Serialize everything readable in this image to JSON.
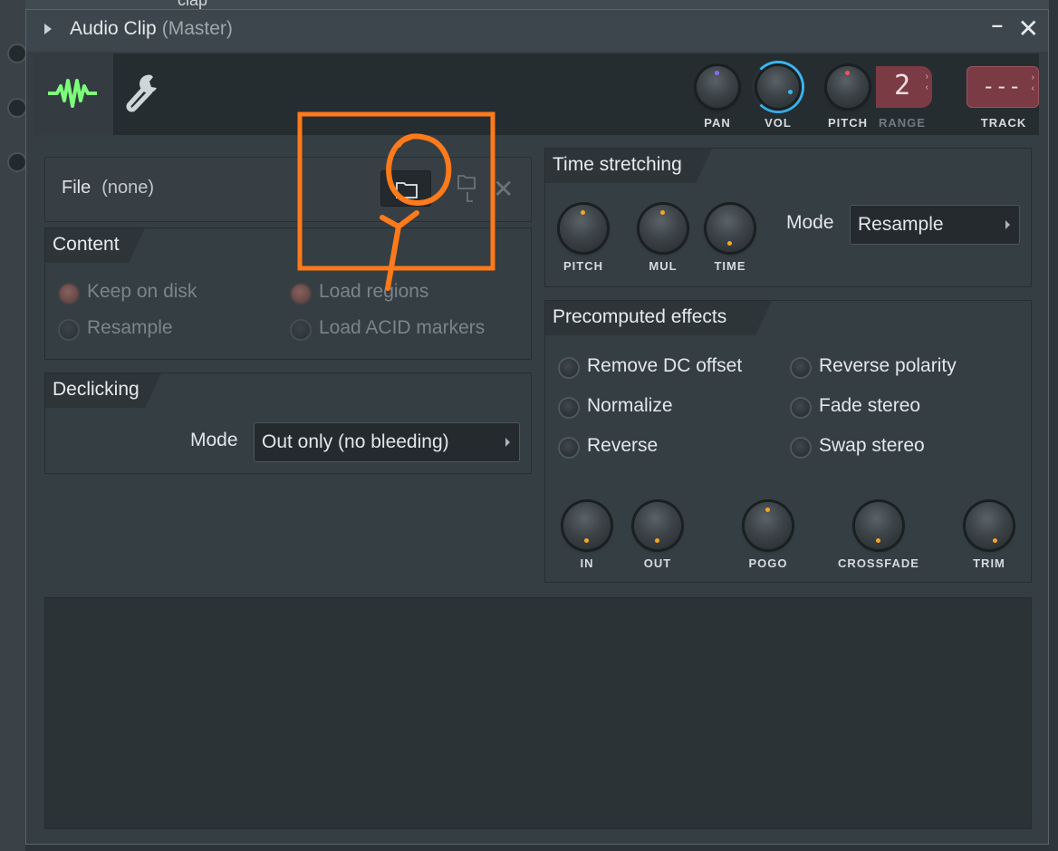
{
  "background": {
    "top_label": "clap"
  },
  "window": {
    "title": "Audio Clip",
    "subtitle": "(Master)",
    "minimize_icon": "minimize-icon",
    "close_icon": "close-icon"
  },
  "toolbar": {
    "tabs": [
      {
        "icon": "waveform-icon",
        "active": true
      },
      {
        "icon": "wrench-icon",
        "active": false
      }
    ],
    "knobs": {
      "pan": "PAN",
      "vol": "VOL",
      "pitch": "PITCH"
    },
    "range": {
      "label": "RANGE",
      "value": "2"
    },
    "track": {
      "label": "TRACK",
      "value": "---"
    }
  },
  "file": {
    "label": "File",
    "value": "(none)"
  },
  "content": {
    "title": "Content",
    "options": [
      {
        "label": "Keep on disk",
        "checked": true
      },
      {
        "label": "Load regions",
        "checked": true
      },
      {
        "label": "Resample",
        "checked": false
      },
      {
        "label": "Load ACID markers",
        "checked": false
      }
    ]
  },
  "declicking": {
    "title": "Declicking",
    "mode_label": "Mode",
    "mode_value": "Out only (no bleeding)"
  },
  "time_stretching": {
    "title": "Time stretching",
    "knobs": [
      "PITCH",
      "MUL",
      "TIME"
    ],
    "mode_label": "Mode",
    "mode_value": "Resample"
  },
  "precomputed": {
    "title": "Precomputed effects",
    "options": [
      {
        "label": "Remove DC offset"
      },
      {
        "label": "Reverse polarity"
      },
      {
        "label": "Normalize"
      },
      {
        "label": "Fade stereo"
      },
      {
        "label": "Reverse"
      },
      {
        "label": "Swap stereo"
      }
    ],
    "knobs": [
      "IN",
      "OUT",
      "POGO",
      "CROSSFADE",
      "TRIM"
    ]
  },
  "colors": {
    "accent_green": "#7dff7a",
    "vol_ring": "#3ab7f0",
    "annotation": "#ff7a1a",
    "track_red": "#7a3b44"
  }
}
